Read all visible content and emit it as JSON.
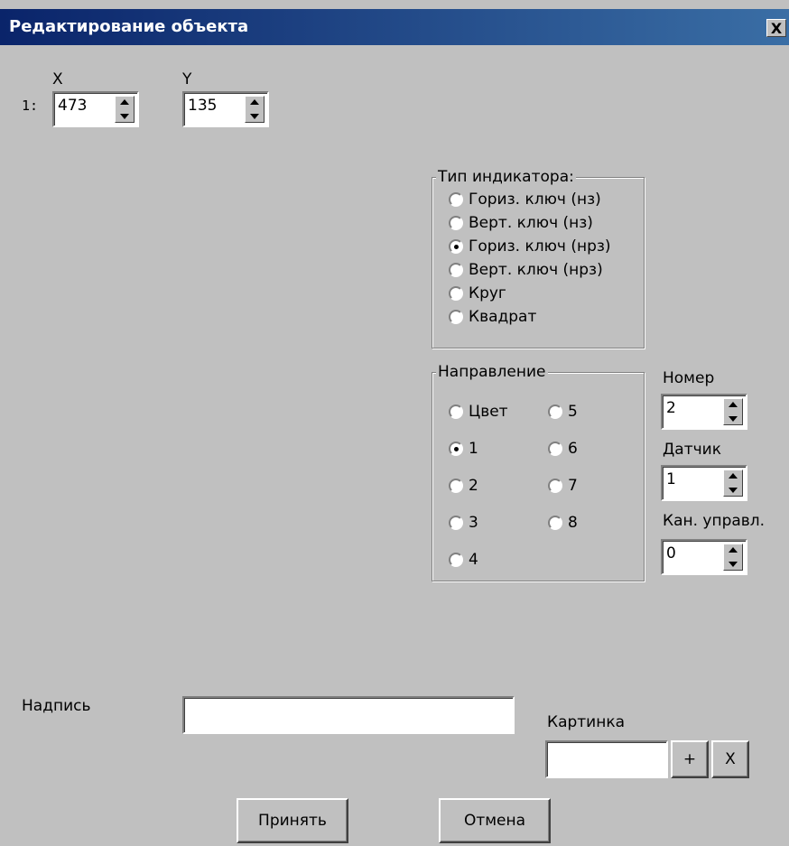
{
  "window": {
    "title": "Редактирование объекта",
    "close_glyph": "X"
  },
  "coords": {
    "x_label": "X",
    "y_label": "Y",
    "row_label": "1:",
    "x_value": "473",
    "y_value": "135"
  },
  "indicator_type": {
    "title": "Тип индикатора:",
    "options": [
      "Гориз. ключ (нз)",
      "Верт. ключ (нз)",
      "Гориз. ключ (нрз)",
      "Верт. ключ (нрз)",
      "Круг",
      "Квадрат"
    ],
    "selected": "Гориз. ключ (нрз)"
  },
  "direction": {
    "title": "Направление",
    "options": [
      "Цвет",
      "1",
      "2",
      "3",
      "4",
      "5",
      "6",
      "7",
      "8"
    ],
    "selected": "1"
  },
  "number": {
    "label": "Номер",
    "value": "2"
  },
  "sensor": {
    "label": "Датчик",
    "value": "1"
  },
  "control_channel": {
    "label": "Кан. управл.",
    "value": "0"
  },
  "caption": {
    "label": "Надпись",
    "value": ""
  },
  "picture": {
    "label": "Картинка",
    "value": "",
    "add_label": "+",
    "remove_label": "X"
  },
  "buttons": {
    "accept": "Принять",
    "cancel": "Отмена"
  }
}
